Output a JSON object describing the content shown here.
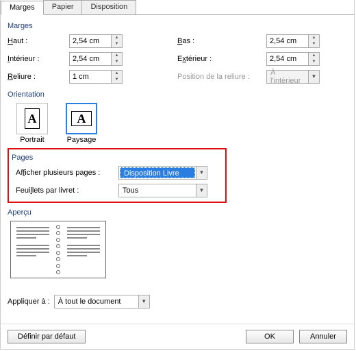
{
  "tabs": {
    "marges": "Marges",
    "papier": "Papier",
    "disposition": "Disposition"
  },
  "groups": {
    "marges": "Marges",
    "orientation": "Orientation",
    "pages": "Pages",
    "apercu": "Aperçu"
  },
  "margins": {
    "top_label": "Haut :",
    "top": "2,54 cm",
    "interior_label": "Intérieur :",
    "interior": "2,54 cm",
    "gutter_label": "Reliure :",
    "gutter": "1 cm",
    "bottom_label": "Bas :",
    "bottom": "2,54 cm",
    "exterior_label": "Extérieur :",
    "exterior": "2,54 cm",
    "gutterpos_label": "Position de la reliure :",
    "gutterpos": "À l'intérieur"
  },
  "orientation": {
    "portrait": "Portrait",
    "paysage": "Paysage"
  },
  "pages": {
    "multi_label": "Afficher plusieurs pages :",
    "multi_value": "Disposition Livre",
    "sheets_label": "Feuillets par livret :",
    "sheets_value": "Tous"
  },
  "apply": {
    "label": "Appliquer à :",
    "value": "À tout le document"
  },
  "buttons": {
    "default": "Définir par défaut",
    "ok": "OK",
    "cancel": "Annuler"
  }
}
